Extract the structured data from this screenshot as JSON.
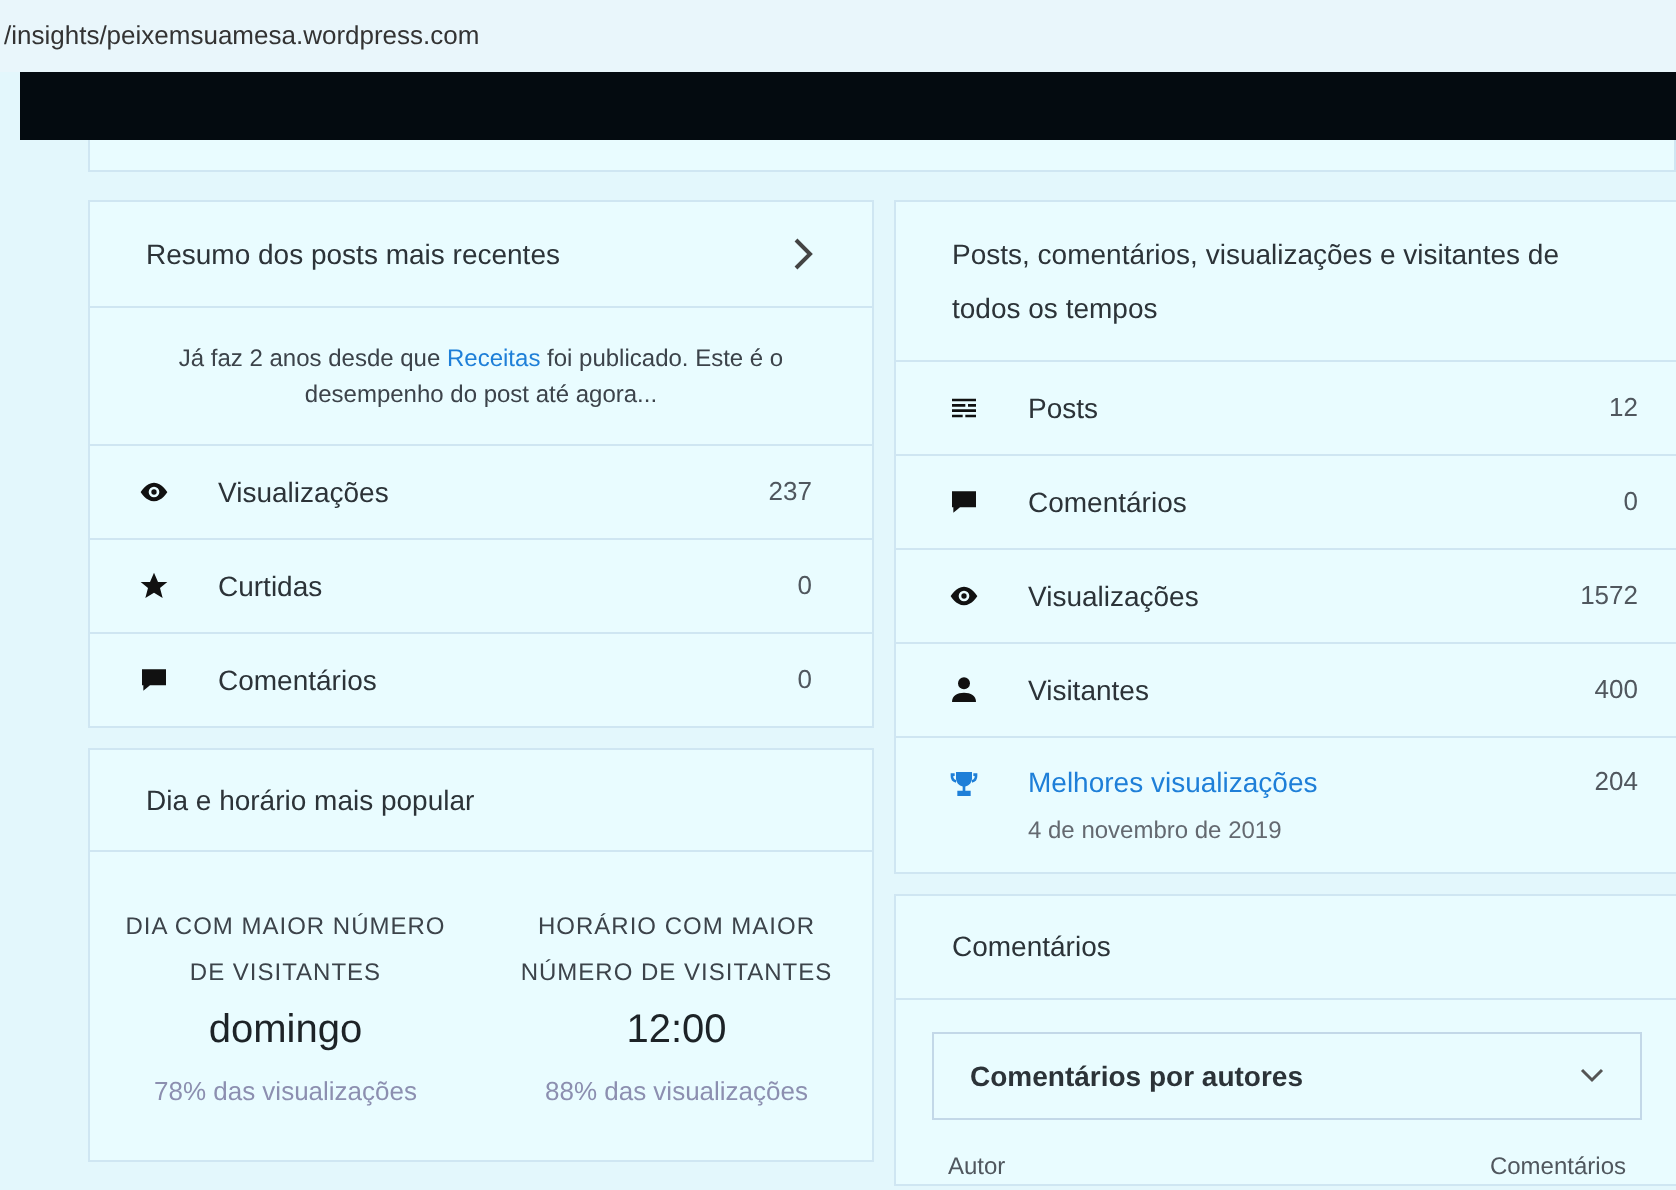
{
  "address_bar": {
    "url": "/insights/peixemsuamesa.wordpress.com"
  },
  "recent_posts": {
    "title": "Resumo dos posts mais recentes",
    "summary": {
      "before": "Já faz 2 anos desde que",
      "link": "Receitas",
      "after": "foi publicado. Este é o desempenho do post até agora..."
    },
    "stats": [
      {
        "kind": "eye",
        "label": "Visualizações",
        "value": "237"
      },
      {
        "kind": "star",
        "label": "Curtidas",
        "value": "0"
      },
      {
        "kind": "comment",
        "label": "Comentários",
        "value": "0"
      }
    ]
  },
  "popular_time": {
    "title": "Dia e horário mais popular",
    "columns": [
      {
        "heading": "DIA COM MAIOR NÚMERO DE VISITANTES",
        "value": "domingo",
        "note": "78% das visualizações"
      },
      {
        "heading": "HORÁRIO COM MAIOR NÚMERO DE VISITANTES",
        "value": "12:00",
        "note": "88% das visualizações"
      }
    ]
  },
  "all_time": {
    "title": "Posts, comentários, visualizações e visitantes de todos os tempos",
    "stats": [
      {
        "kind": "posts",
        "label": "Posts",
        "value": "12"
      },
      {
        "kind": "comment",
        "label": "Comentários",
        "value": "0"
      },
      {
        "kind": "eye",
        "label": "Visualizações",
        "value": "1572"
      },
      {
        "kind": "person",
        "label": "Visitantes",
        "value": "400"
      },
      {
        "kind": "trophy",
        "label": "Melhores visualizações",
        "value": "204",
        "date": "4 de novembro de 2019"
      }
    ]
  },
  "comments": {
    "title": "Comentários",
    "dropdown": "Comentários por autores",
    "columns": [
      "Autor",
      "Comentários"
    ]
  }
}
